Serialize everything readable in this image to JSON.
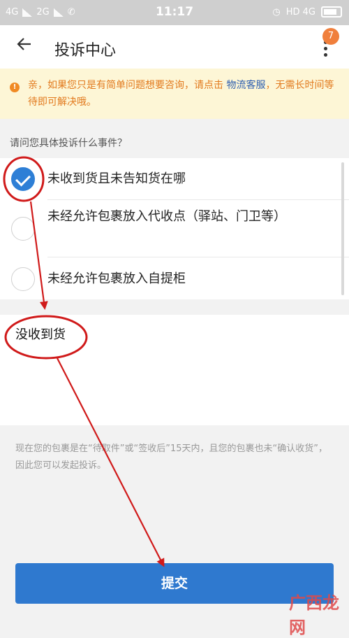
{
  "status_bar": {
    "left_signals": [
      "4G",
      "2G"
    ],
    "time": "11:17",
    "right_text": "HD 4G"
  },
  "header": {
    "back_icon": "arrow-left-icon",
    "title": "投诉中心",
    "badge_count": "7",
    "menu_icon": "more-vertical-icon"
  },
  "notice": {
    "text_before": "亲，如果您只是有简单问题想要咨询，请点击",
    "link": "物流客服",
    "text_after": "，无需长时间等待即可解决哦。"
  },
  "question": "请问您具体投诉什么事件？",
  "options": [
    {
      "label": "未收到货且未告知货在哪",
      "checked": true
    },
    {
      "label": "未经允许包裹放入代收点（驿站、门卫等）",
      "checked": false
    },
    {
      "label": "未经允许包裹放入自提柜",
      "checked": false
    }
  ],
  "description": {
    "value": "没收到货"
  },
  "hint": "现在您的包裹是在“待取件”或“签收后”15天内，且您的包裹也未“确认收货”，因此您可以发起投诉。",
  "submit_label": "提交",
  "watermark": "广西龙网",
  "colors": {
    "accent": "#2f79cf",
    "notice_bg": "#fdf6d6",
    "notice_text": "#e27a1e",
    "annotation_red": "#d01a1a"
  }
}
